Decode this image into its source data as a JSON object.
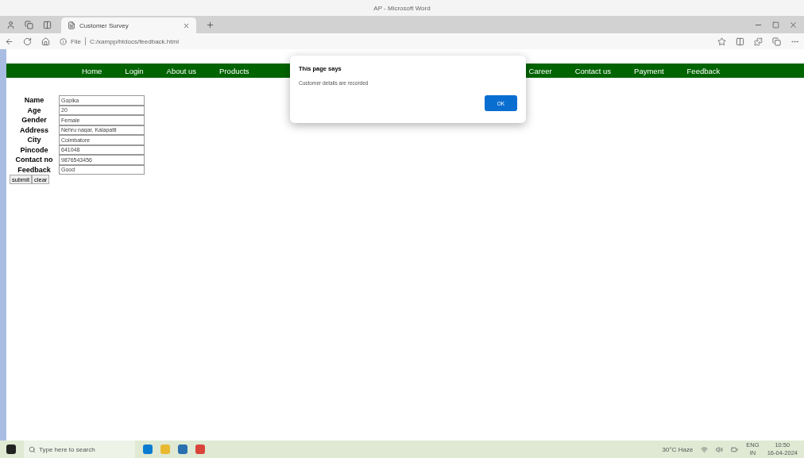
{
  "word_window": {
    "title": "AP - Microsoft Word"
  },
  "browser": {
    "tab": {
      "title": "Customer Survey"
    },
    "address": {
      "scheme": "File",
      "url": "C:/xampp/htdocs/feedback.html"
    }
  },
  "nav": {
    "left": [
      {
        "label": "Home"
      },
      {
        "label": "Login"
      },
      {
        "label": "About us"
      },
      {
        "label": "Products"
      }
    ],
    "right": [
      {
        "label": "Career"
      },
      {
        "label": "Contact us"
      },
      {
        "label": "Payment"
      },
      {
        "label": "Feedback"
      }
    ]
  },
  "form": {
    "fields": [
      {
        "label": "Name",
        "value": "Gopika"
      },
      {
        "label": "Age",
        "value": "20"
      },
      {
        "label": "Gender",
        "value": "Female"
      },
      {
        "label": "Address",
        "value": "Nehru nagar, Kalapatti"
      },
      {
        "label": "City",
        "value": "Coimbatore"
      },
      {
        "label": "Pincode",
        "value": "641048"
      },
      {
        "label": "Contact no",
        "value": "9876543456"
      },
      {
        "label": "Feedback",
        "value": "Good"
      }
    ],
    "buttons": [
      "submit",
      "clear"
    ]
  },
  "dialog": {
    "title": "This page says",
    "message": "Customer details are recorded",
    "button": "OK"
  },
  "taskbar": {
    "search": {
      "placeholder": "Type here to search"
    },
    "weather": "30°C Haze",
    "language": [
      "ENG",
      "IN"
    ],
    "time": "10:50",
    "date": "16-04-2024"
  }
}
